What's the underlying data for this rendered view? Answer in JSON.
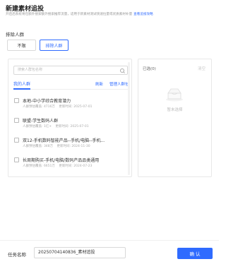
{
  "header": {
    "title": "新建素材追投",
    "subtitle": "开启后系统将在额外搜索额外搜索推荐流量，适用于新素材测试快速拉量或优质素材补量",
    "subtitle_link": "查看追投攻略"
  },
  "exclude": {
    "label": "排除人群",
    "options": [
      "不限",
      "排除人群"
    ],
    "selected": "排除人群"
  },
  "audience_panel": {
    "search_placeholder": "搜索人群包名称",
    "tab": "我的人群",
    "refresh": "刷新",
    "manage": "管理人群包",
    "items": [
      {
        "name": "本地-中小学综合教育潜力",
        "coverage": "人群预估覆盖: 4716万",
        "updated": "更新时间: 2025-07-01"
      },
      {
        "name": "联盟-学生数码人群",
        "coverage": "人群预估覆盖: 1亿+",
        "updated": "更新时间: 2025-07-01"
      },
      {
        "name": "双12-手机数码智能产品--手机/电脑--手机...",
        "coverage": "人群预估覆盖: 348万",
        "updated": "更新时间: 2024-11-30"
      },
      {
        "name": "长周期购买-手机/电脑/数码产品品类通用",
        "coverage": "人群预估覆盖: 6651万",
        "updated": "更新时间: 2024-07-23"
      }
    ]
  },
  "selected_panel": {
    "heading": "已选(0)",
    "clear": "清空",
    "empty_text": "暂未选择"
  },
  "footer": {
    "task_label": "任务名称",
    "task_value": "20250704140836_素材追投",
    "confirm": "确 认"
  }
}
